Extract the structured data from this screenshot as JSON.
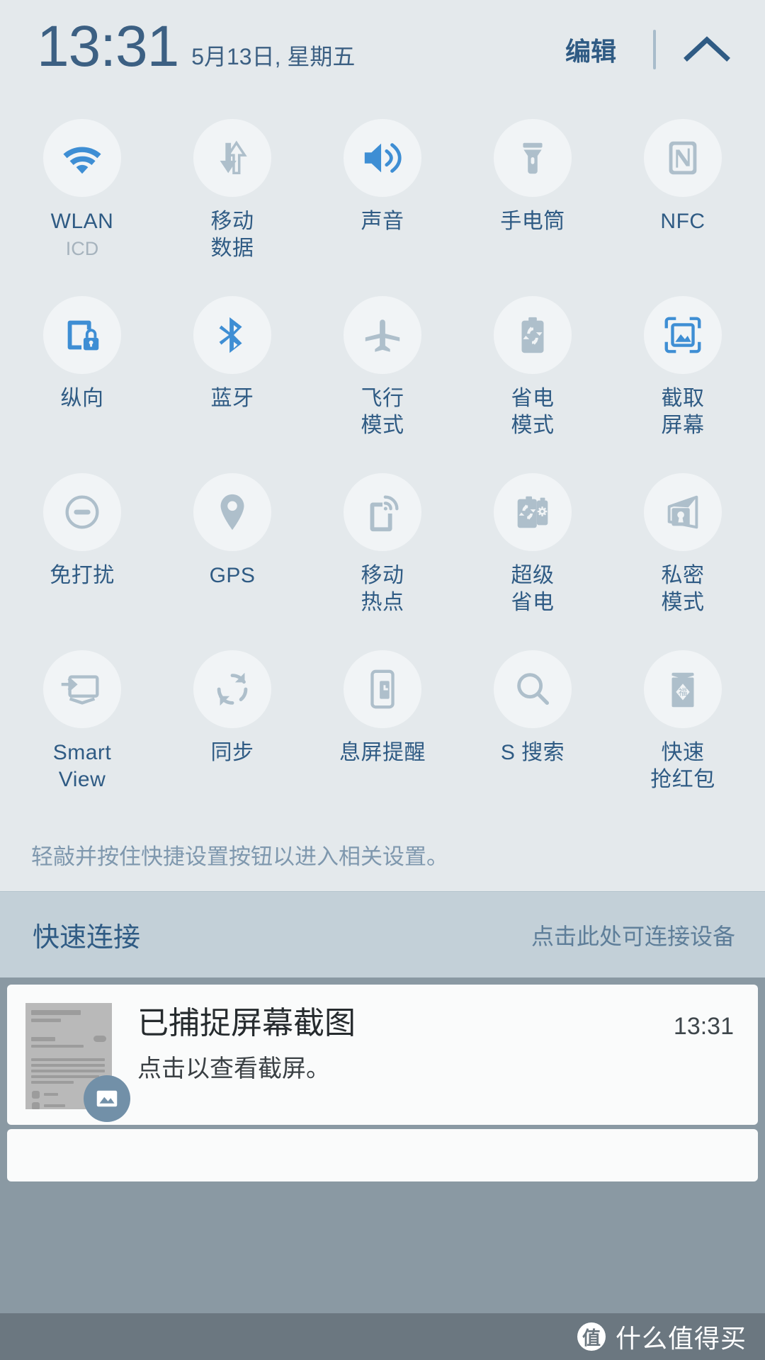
{
  "header": {
    "time": "13:31",
    "date": "5月13日, 星期五",
    "edit_label": "编辑",
    "collapse_icon": "chevron-up-icon"
  },
  "quick_settings": {
    "hint": "轻敲并按住快捷设置按钮以进入相关设置。",
    "toggles": [
      {
        "label": "WLAN",
        "sub": "ICD",
        "icon": "wifi-icon",
        "active": true
      },
      {
        "label": "移动\n数据",
        "sub": "",
        "icon": "mobile-data-icon",
        "active": false
      },
      {
        "label": "声音",
        "sub": "",
        "icon": "sound-icon",
        "active": true
      },
      {
        "label": "手电筒",
        "sub": "",
        "icon": "flashlight-icon",
        "active": false
      },
      {
        "label": "NFC",
        "sub": "",
        "icon": "nfc-icon",
        "active": false
      },
      {
        "label": "纵向",
        "sub": "",
        "icon": "rotation-lock-icon",
        "active": true
      },
      {
        "label": "蓝牙",
        "sub": "",
        "icon": "bluetooth-icon",
        "active": true
      },
      {
        "label": "飞行\n模式",
        "sub": "",
        "icon": "airplane-icon",
        "active": false
      },
      {
        "label": "省电\n模式",
        "sub": "",
        "icon": "power-saving-icon",
        "active": false
      },
      {
        "label": "截取\n屏幕",
        "sub": "",
        "icon": "screenshot-icon",
        "active": true
      },
      {
        "label": "免打扰",
        "sub": "",
        "icon": "do-not-disturb-icon",
        "active": false
      },
      {
        "label": "GPS",
        "sub": "",
        "icon": "location-pin-icon",
        "active": false
      },
      {
        "label": "移动\n热点",
        "sub": "",
        "icon": "hotspot-icon",
        "active": false
      },
      {
        "label": "超级\n省电",
        "sub": "",
        "icon": "ultra-power-saving-icon",
        "active": false
      },
      {
        "label": "私密\n模式",
        "sub": "",
        "icon": "private-mode-icon",
        "active": false
      },
      {
        "label": "Smart\nView",
        "sub": "",
        "icon": "smart-view-icon",
        "active": false
      },
      {
        "label": "同步",
        "sub": "",
        "icon": "sync-icon",
        "active": false
      },
      {
        "label": "息屏提醒",
        "sub": "",
        "icon": "always-on-display-icon",
        "active": false
      },
      {
        "label": "S 搜索",
        "sub": "",
        "icon": "search-icon",
        "active": false
      },
      {
        "label": "快速\n抢红包",
        "sub": "",
        "icon": "red-envelope-icon",
        "active": false
      }
    ]
  },
  "quick_connect": {
    "title": "快速连接",
    "action": "点击此处可连接设备"
  },
  "notifications": [
    {
      "title": "已捕捉屏幕截图",
      "body": "点击以查看截屏。",
      "time": "13:31",
      "badge_icon": "image-icon"
    }
  ],
  "watermark": {
    "logo": "值",
    "text": "什么值得买"
  },
  "colors": {
    "active": "#3e8ed4",
    "inactive": "#aebfcb",
    "label": "#2f5b84",
    "background": "#e4e9ec",
    "circle": "#f1f4f6",
    "quick_connect_bg": "#c3d0d8",
    "notif_area_bg": "#8a99a3",
    "watermark_bg": "#6b7780"
  }
}
